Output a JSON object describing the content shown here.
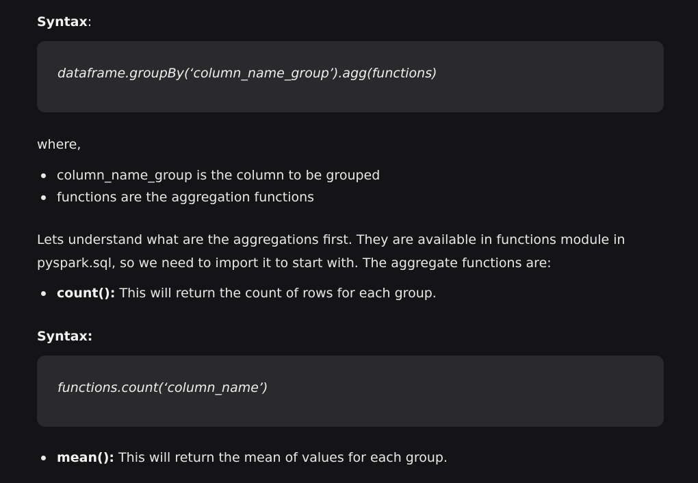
{
  "syntax1": {
    "label": "Syntax",
    "colon": ":",
    "code": "dataframe.groupBy(‘column_name_group’).agg(functions)"
  },
  "where": {
    "text": "where,",
    "items": [
      "column_name_group is the column to be grouped",
      "functions are the aggregation functions"
    ]
  },
  "intro": {
    "line1": "Lets understand what are the aggregations first. They are available in functions module in",
    "line2": "pyspark.sql, so we need to import it to start with. The aggregate functions are:"
  },
  "count_item": {
    "term": "count():",
    "desc": " This will return the count of rows for each group."
  },
  "syntax2": {
    "label": "Syntax:",
    "code": "functions.count(‘column_name’)"
  },
  "mean_item": {
    "term": "mean():",
    "desc": " This will return the mean of values for each group."
  }
}
